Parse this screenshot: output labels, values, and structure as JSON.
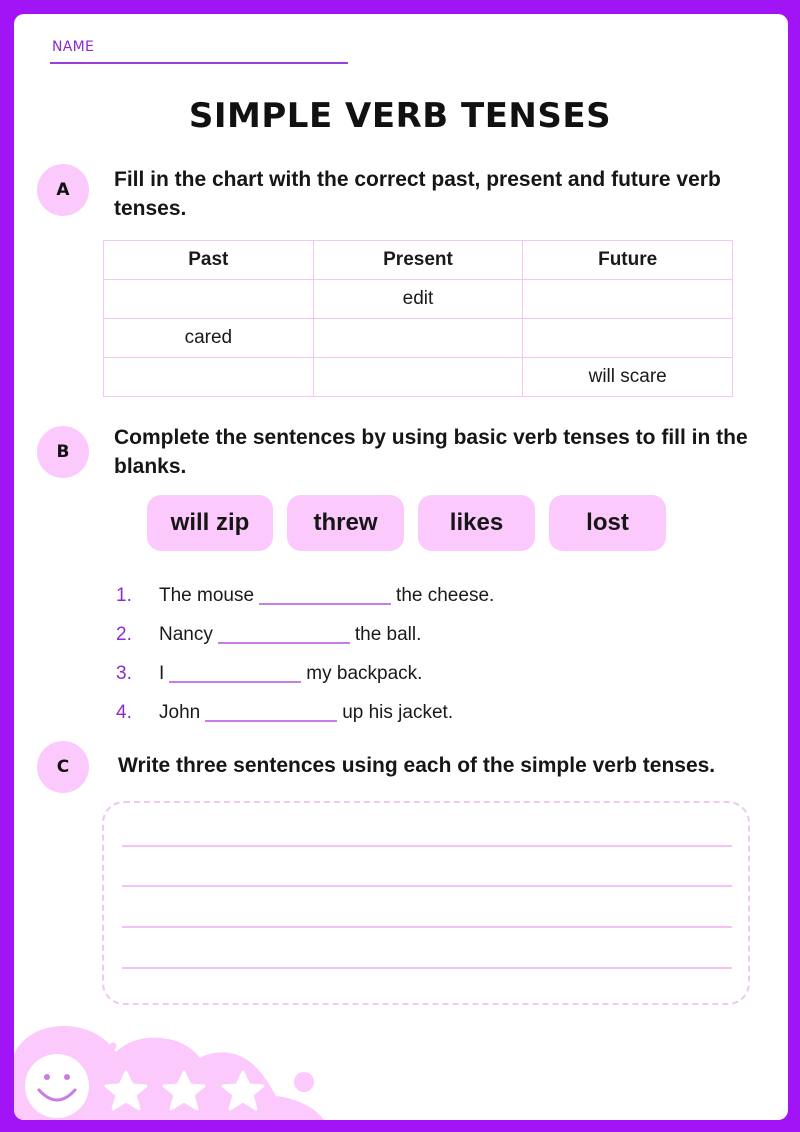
{
  "worksheet": {
    "name_label": "NAME",
    "title": "SIMPLE VERB TENSES"
  },
  "section_a": {
    "badge": "A",
    "instruction": "Fill in the chart with the correct past, present and future verb tenses.",
    "table": {
      "headers": [
        "Past",
        "Present",
        "Future"
      ],
      "rows": [
        [
          "",
          "edit",
          ""
        ],
        [
          "cared",
          "",
          ""
        ],
        [
          "",
          "",
          "will scare"
        ]
      ]
    }
  },
  "section_b": {
    "badge": "B",
    "instruction": "Complete the sentences by using basic verb tenses to fill in the blanks.",
    "word_bank": [
      "will zip",
      "threw",
      "likes",
      "lost"
    ],
    "sentences": [
      {
        "number": "1.",
        "before": "The mouse",
        "after": "the cheese."
      },
      {
        "number": "2.",
        "before": "Nancy",
        "after": "the ball."
      },
      {
        "number": "3.",
        "before": "I",
        "after": "my backpack."
      },
      {
        "number": "4.",
        "before": "John",
        "after": "up his jacket."
      }
    ]
  },
  "section_c": {
    "badge": "C",
    "instruction": "Write three sentences using each of the simple verb tenses.",
    "writing_lines": 4
  },
  "decoration": {
    "icons": [
      "smiley-face-icon",
      "star-icon",
      "star-icon",
      "star-icon"
    ]
  },
  "colors": {
    "frame": "#a014f5",
    "accent_purple": "#8b2bd0",
    "pink_fill": "#fbc9fb",
    "pink_line": "#f3c6f3"
  }
}
